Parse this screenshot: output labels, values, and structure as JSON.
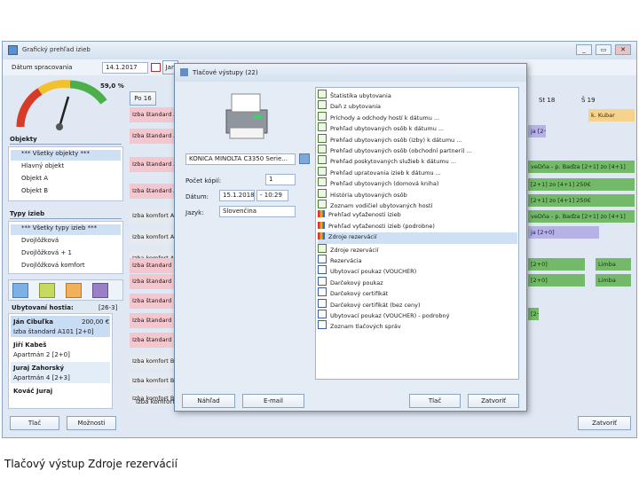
{
  "window": {
    "title": "Grafický prehľad izieb",
    "date_label": "Dátum spracovania",
    "date_value": "14.1.2017",
    "min_label": "_",
    "restore_label": "▭",
    "close_label": "✕"
  },
  "gauge": {
    "value_label": "59,0 %",
    "scale": [
      "0",
      "20",
      "40",
      "60",
      "80",
      "100",
      "120",
      "140"
    ]
  },
  "toolbar": {
    "day_label": "Po 16",
    "today_label": "Jan"
  },
  "objects": {
    "header": "Objekty",
    "items": [
      "*** Všetky objekty ***",
      "Hlavný objekt",
      "Objekt A",
      "Objekt B"
    ]
  },
  "room_types": {
    "header": "Typy izieb",
    "items": [
      "*** Všetky typy izieb ***",
      "Dvojlôžková",
      "Dvojlôžková + 1",
      "Dvojlôžková komfort"
    ]
  },
  "guests": {
    "header": "Ubytovaní hostia:",
    "count": "[26-3]",
    "items": [
      {
        "name": "Ján Cibuľka",
        "amount": "200,00 €",
        "room": "Izba štandard A101 [2+0]"
      },
      {
        "name": "Jiří Kabeš",
        "amount": "",
        "room": "Apartmán 2 [2+0]"
      },
      {
        "name": "Juraj Zahorský",
        "amount": "",
        "room": "Apartmán 4 [2+3]"
      },
      {
        "name": "Kováč Juraj",
        "amount": "",
        "room": ""
      }
    ]
  },
  "rooms": [
    "Izba štandard A",
    "Izba štandard A",
    "Izba štandard A",
    "Izba štandard A",
    "Izba komfort A1",
    "Izba komfort A2",
    "Izba komfort A2",
    "Izba štandard B",
    "Izba štandard B",
    "Izba štandard B",
    "Izba štandard B",
    "Izba štandard B",
    "Izba komfort B1",
    "Izba komfort B1",
    "Izba komfort B2"
  ],
  "room_bottom": "Izba komfort B2",
  "grid": {
    "col_st": "St 18",
    "col_st19": "Š 19",
    "bars": {
      "b1": "k. Kubar",
      "b2": "veDňa - p. Baďza [2+1] zo [4+1]",
      "b3": "[2+1] zo [4+1]  250€",
      "b4": "[2+1] zo [4+1]  250€",
      "b5": "veDňa - p. Baďza [2+1] zo [4+1]",
      "b6": "ja [2+0]",
      "b7": "[2+0]",
      "b8": "Limba",
      "b9": "[2+0]",
      "b10": "Limba",
      "b11": "[2+0]"
    }
  },
  "bottom": {
    "print_label": "Tlač",
    "options_label": "Možnosti",
    "close_label": "Zatvoriť"
  },
  "dialog": {
    "title": "Tlačové výstupy (22)",
    "printer": "KONICA MINOLTA C3350 Serie...",
    "copies_label": "Počet kópií:",
    "copies_value": "1",
    "date_label": "Dátum:",
    "date_value": "15.1.2018",
    "time_value": "- 10:29",
    "lang_label": "Jazyk:",
    "lang_value": "Slovenčina",
    "reports": [
      {
        "label": "Štatistika ubytovania",
        "icon": "doc"
      },
      {
        "label": "Daň z ubytovania",
        "icon": "doc"
      },
      {
        "label": "Príchody a odchody hostí k dátumu ...",
        "icon": "doc"
      },
      {
        "label": "Prehľad ubytovaných osôb k dátumu ...",
        "icon": "doc"
      },
      {
        "label": "Prehľad ubytovaných osôb (izby) k dátumu ...",
        "icon": "doc"
      },
      {
        "label": "Prehľad ubytovaných osôb (obchodní partneri) ...",
        "icon": "doc"
      },
      {
        "label": "Prehľad poskytovaných služieb k dátumu ...",
        "icon": "doc"
      },
      {
        "label": "Prehľad upratovania izieb k dátumu ...",
        "icon": "doc"
      },
      {
        "label": "Prehľad ubytovaných (domová kniha)",
        "icon": "doc"
      },
      {
        "label": "História ubytovaných osôb",
        "icon": "doc"
      },
      {
        "label": "Zoznam vodičiel ubytovaných hostí",
        "icon": "doc"
      },
      {
        "label": "Prehľad vyťaženosti izieb",
        "icon": "chart"
      },
      {
        "label": "Prehľad vyťaženosti izieb (podrobne)",
        "icon": "chart"
      },
      {
        "label": "Zdroje rezervácií",
        "icon": "chart"
      },
      {
        "label": "Zdroje rezervácií",
        "icon": "doc"
      },
      {
        "label": "Rezervácia",
        "icon": "x"
      },
      {
        "label": "Ubytovací poukaz (VOUCHER)",
        "icon": "x"
      },
      {
        "label": "Darčekový poukaz",
        "icon": "x"
      },
      {
        "label": "Darčekový certifikát",
        "icon": "x"
      },
      {
        "label": "Darčekový certifikát (bez ceny)",
        "icon": "x"
      },
      {
        "label": "Ubytovací poukaz (VOUCHER) - podrobný",
        "icon": "x"
      },
      {
        "label": "Zoznam tlačových správ",
        "icon": "x"
      }
    ],
    "selected_index": 13,
    "preview_label": "Náhľad",
    "email_label": "E-mail",
    "print_label": "Tlač",
    "close_label": "Zatvoriť"
  },
  "caption": "Tlačový výstup Zdroje rezervácií"
}
